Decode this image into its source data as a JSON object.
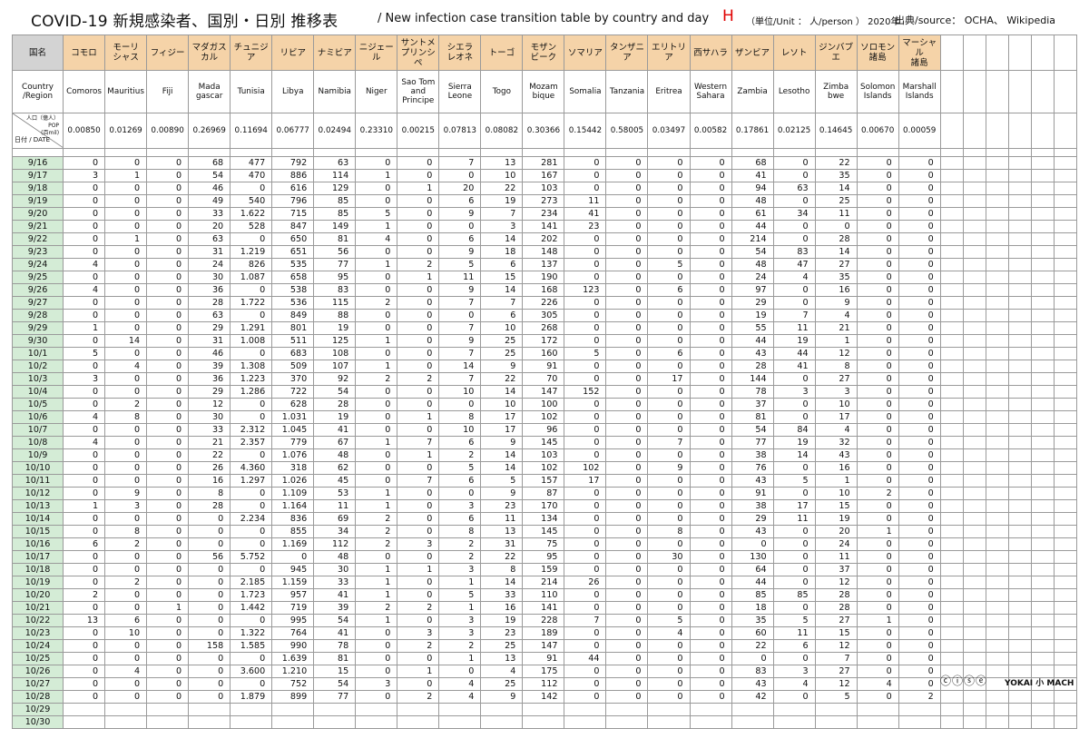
{
  "title": {
    "main": "COVID-19  新規感染者、国別・日別 推移表",
    "sub": "/ New infection case transition table by country and day",
    "letter": "H",
    "unit": "（単位/Unit ： 人/person ） 2020年",
    "source": "出典/source： OCHA、 Wikipedia"
  },
  "header": {
    "corner_ja": "国名",
    "country_region": "Country\n/Region",
    "pop_label": "人口（億人）\nPOP\n(百mil)",
    "date_label": "日付 / DATE"
  },
  "countries": [
    {
      "ja": "コモロ",
      "en": "Comoros",
      "pop": "0.00850"
    },
    {
      "ja": "モーリ\nシャス",
      "en": "Mauritius",
      "pop": "0.01269"
    },
    {
      "ja": "フィジー",
      "en": "Fiji",
      "pop": "0.00890"
    },
    {
      "ja": "マダガス\nカル",
      "en": "Mada\ngascar",
      "pop": "0.26969"
    },
    {
      "ja": "チュニジア",
      "en": "Tunisia",
      "pop": "0.11694"
    },
    {
      "ja": "リビア",
      "en": "Libya",
      "pop": "0.06777"
    },
    {
      "ja": "ナミビア",
      "en": "Namibia",
      "pop": "0.02494"
    },
    {
      "ja": "ニジェール",
      "en": "Niger",
      "pop": "0.23310"
    },
    {
      "ja": "サントメ\nプリンシペ",
      "en": "Sao Tom\nand\nPrincipe",
      "pop": "0.00215"
    },
    {
      "ja": "シエラ\nレオネ",
      "en": "Sierra\nLeone",
      "pop": "0.07813"
    },
    {
      "ja": "トーゴ",
      "en": "Togo",
      "pop": "0.08082"
    },
    {
      "ja": "モザン\nビーク",
      "en": "Mozam\nbique",
      "pop": "0.30366"
    },
    {
      "ja": "ソマリア",
      "en": "Somalia",
      "pop": "0.15442"
    },
    {
      "ja": "タンザニア",
      "en": "Tanzania",
      "pop": "0.58005"
    },
    {
      "ja": "エリトリア",
      "en": "Eritrea",
      "pop": "0.03497"
    },
    {
      "ja": "西サハラ",
      "en": "Western\nSahara",
      "pop": "0.00582"
    },
    {
      "ja": "ザンビア",
      "en": "Zambia",
      "pop": "0.17861"
    },
    {
      "ja": "レソト",
      "en": "Lesotho",
      "pop": "0.02125"
    },
    {
      "ja": "ジンバブエ",
      "en": "Zimba\nbwe",
      "pop": "0.14645"
    },
    {
      "ja": "ソロモン\n諸島",
      "en": "Solomon\nIslands",
      "pop": "0.00670"
    },
    {
      "ja": "マーシャル\n諸島",
      "en": "Marshall\nIslands",
      "pop": "0.00059"
    }
  ],
  "rows": [
    {
      "date": "9/16",
      "v": [
        "0",
        "0",
        "0",
        "68",
        "477",
        "792",
        "63",
        "0",
        "0",
        "7",
        "13",
        "281",
        "0",
        "0",
        "0",
        "0",
        "68",
        "0",
        "22",
        "0",
        "0"
      ]
    },
    {
      "date": "9/17",
      "v": [
        "3",
        "1",
        "0",
        "54",
        "470",
        "886",
        "114",
        "1",
        "0",
        "0",
        "10",
        "167",
        "0",
        "0",
        "0",
        "0",
        "41",
        "0",
        "35",
        "0",
        "0"
      ]
    },
    {
      "date": "9/18",
      "v": [
        "0",
        "0",
        "0",
        "46",
        "0",
        "616",
        "129",
        "0",
        "1",
        "20",
        "22",
        "103",
        "0",
        "0",
        "0",
        "0",
        "94",
        "63",
        "14",
        "0",
        "0"
      ]
    },
    {
      "date": "9/19",
      "v": [
        "0",
        "0",
        "0",
        "49",
        "540",
        "796",
        "85",
        "0",
        "0",
        "6",
        "19",
        "273",
        "11",
        "0",
        "0",
        "0",
        "48",
        "0",
        "25",
        "0",
        "0"
      ]
    },
    {
      "date": "9/20",
      "v": [
        "0",
        "0",
        "0",
        "33",
        "1.622",
        "715",
        "85",
        "5",
        "0",
        "9",
        "7",
        "234",
        "41",
        "0",
        "0",
        "0",
        "61",
        "34",
        "11",
        "0",
        "0"
      ]
    },
    {
      "date": "9/21",
      "v": [
        "0",
        "0",
        "0",
        "20",
        "528",
        "847",
        "149",
        "1",
        "0",
        "0",
        "3",
        "141",
        "23",
        "0",
        "0",
        "0",
        "44",
        "0",
        "0",
        "0",
        "0"
      ]
    },
    {
      "date": "9/22",
      "v": [
        "0",
        "1",
        "0",
        "63",
        "0",
        "650",
        "81",
        "4",
        "0",
        "6",
        "14",
        "202",
        "0",
        "0",
        "0",
        "0",
        "214",
        "0",
        "28",
        "0",
        "0"
      ]
    },
    {
      "date": "9/23",
      "v": [
        "0",
        "0",
        "0",
        "31",
        "1.219",
        "651",
        "56",
        "0",
        "0",
        "9",
        "18",
        "148",
        "0",
        "0",
        "0",
        "0",
        "54",
        "83",
        "14",
        "0",
        "0"
      ]
    },
    {
      "date": "9/24",
      "v": [
        "4",
        "0",
        "0",
        "24",
        "826",
        "535",
        "77",
        "1",
        "2",
        "5",
        "6",
        "137",
        "0",
        "0",
        "5",
        "0",
        "48",
        "47",
        "27",
        "0",
        "0"
      ]
    },
    {
      "date": "9/25",
      "v": [
        "0",
        "0",
        "0",
        "30",
        "1.087",
        "658",
        "95",
        "0",
        "1",
        "11",
        "15",
        "190",
        "0",
        "0",
        "0",
        "0",
        "24",
        "4",
        "35",
        "0",
        "0"
      ]
    },
    {
      "date": "9/26",
      "v": [
        "4",
        "0",
        "0",
        "36",
        "0",
        "538",
        "83",
        "0",
        "0",
        "9",
        "14",
        "168",
        "123",
        "0",
        "6",
        "0",
        "97",
        "0",
        "16",
        "0",
        "0"
      ]
    },
    {
      "date": "9/27",
      "v": [
        "0",
        "0",
        "0",
        "28",
        "1.722",
        "536",
        "115",
        "2",
        "0",
        "7",
        "7",
        "226",
        "0",
        "0",
        "0",
        "0",
        "29",
        "0",
        "9",
        "0",
        "0"
      ]
    },
    {
      "date": "9/28",
      "v": [
        "0",
        "0",
        "0",
        "63",
        "0",
        "849",
        "88",
        "0",
        "0",
        "0",
        "6",
        "305",
        "0",
        "0",
        "0",
        "0",
        "19",
        "7",
        "4",
        "0",
        "0"
      ]
    },
    {
      "date": "9/29",
      "v": [
        "1",
        "0",
        "0",
        "29",
        "1.291",
        "801",
        "19",
        "0",
        "0",
        "7",
        "10",
        "268",
        "0",
        "0",
        "0",
        "0",
        "55",
        "11",
        "21",
        "0",
        "0"
      ]
    },
    {
      "date": "9/30",
      "v": [
        "0",
        "14",
        "0",
        "31",
        "1.008",
        "511",
        "125",
        "1",
        "0",
        "9",
        "25",
        "172",
        "0",
        "0",
        "0",
        "0",
        "44",
        "19",
        "1",
        "0",
        "0"
      ]
    },
    {
      "date": "10/1",
      "v": [
        "5",
        "0",
        "0",
        "46",
        "0",
        "683",
        "108",
        "0",
        "0",
        "7",
        "25",
        "160",
        "5",
        "0",
        "6",
        "0",
        "43",
        "44",
        "12",
        "0",
        "0"
      ]
    },
    {
      "date": "10/2",
      "v": [
        "0",
        "4",
        "0",
        "39",
        "1.308",
        "509",
        "107",
        "1",
        "0",
        "14",
        "9",
        "91",
        "0",
        "0",
        "0",
        "0",
        "28",
        "41",
        "8",
        "0",
        "0"
      ]
    },
    {
      "date": "10/3",
      "v": [
        "3",
        "0",
        "0",
        "36",
        "1.223",
        "370",
        "92",
        "2",
        "2",
        "7",
        "22",
        "70",
        "0",
        "0",
        "17",
        "0",
        "144",
        "0",
        "27",
        "0",
        "0"
      ]
    },
    {
      "date": "10/4",
      "v": [
        "0",
        "0",
        "0",
        "29",
        "1.286",
        "722",
        "54",
        "0",
        "0",
        "10",
        "14",
        "147",
        "152",
        "0",
        "0",
        "0",
        "78",
        "3",
        "3",
        "0",
        "0"
      ]
    },
    {
      "date": "10/5",
      "v": [
        "0",
        "2",
        "0",
        "12",
        "0",
        "628",
        "28",
        "0",
        "0",
        "0",
        "10",
        "100",
        "0",
        "0",
        "0",
        "0",
        "37",
        "0",
        "10",
        "0",
        "0"
      ]
    },
    {
      "date": "10/6",
      "v": [
        "4",
        "8",
        "0",
        "30",
        "0",
        "1.031",
        "19",
        "0",
        "1",
        "8",
        "17",
        "102",
        "0",
        "0",
        "0",
        "0",
        "81",
        "0",
        "17",
        "0",
        "0"
      ]
    },
    {
      "date": "10/7",
      "v": [
        "0",
        "0",
        "0",
        "33",
        "2.312",
        "1.045",
        "41",
        "0",
        "0",
        "10",
        "17",
        "96",
        "0",
        "0",
        "0",
        "0",
        "54",
        "84",
        "4",
        "0",
        "0"
      ]
    },
    {
      "date": "10/8",
      "v": [
        "4",
        "0",
        "0",
        "21",
        "2.357",
        "779",
        "67",
        "1",
        "7",
        "6",
        "9",
        "145",
        "0",
        "0",
        "7",
        "0",
        "77",
        "19",
        "32",
        "0",
        "0"
      ]
    },
    {
      "date": "10/9",
      "v": [
        "0",
        "0",
        "0",
        "22",
        "0",
        "1.076",
        "48",
        "0",
        "1",
        "2",
        "14",
        "103",
        "0",
        "0",
        "0",
        "0",
        "38",
        "14",
        "43",
        "0",
        "0"
      ]
    },
    {
      "date": "10/10",
      "v": [
        "0",
        "0",
        "0",
        "26",
        "4.360",
        "318",
        "62",
        "0",
        "0",
        "5",
        "14",
        "102",
        "102",
        "0",
        "9",
        "0",
        "76",
        "0",
        "16",
        "0",
        "0"
      ]
    },
    {
      "date": "10/11",
      "v": [
        "0",
        "0",
        "0",
        "16",
        "1.297",
        "1.026",
        "45",
        "0",
        "7",
        "6",
        "5",
        "157",
        "17",
        "0",
        "0",
        "0",
        "43",
        "5",
        "1",
        "0",
        "0"
      ]
    },
    {
      "date": "10/12",
      "v": [
        "0",
        "9",
        "0",
        "8",
        "0",
        "1.109",
        "53",
        "1",
        "0",
        "0",
        "9",
        "87",
        "0",
        "0",
        "0",
        "0",
        "91",
        "0",
        "10",
        "2",
        "0"
      ]
    },
    {
      "date": "10/13",
      "v": [
        "1",
        "3",
        "0",
        "28",
        "0",
        "1.164",
        "11",
        "1",
        "0",
        "3",
        "23",
        "170",
        "0",
        "0",
        "0",
        "0",
        "38",
        "17",
        "15",
        "0",
        "0"
      ]
    },
    {
      "date": "10/14",
      "v": [
        "0",
        "0",
        "0",
        "0",
        "2.234",
        "836",
        "69",
        "2",
        "0",
        "6",
        "11",
        "134",
        "0",
        "0",
        "0",
        "0",
        "29",
        "11",
        "19",
        "0",
        "0"
      ]
    },
    {
      "date": "10/15",
      "v": [
        "0",
        "8",
        "0",
        "0",
        "0",
        "855",
        "34",
        "2",
        "0",
        "8",
        "13",
        "145",
        "0",
        "0",
        "8",
        "0",
        "43",
        "0",
        "20",
        "1",
        "0"
      ]
    },
    {
      "date": "10/16",
      "v": [
        "6",
        "2",
        "0",
        "0",
        "0",
        "1.169",
        "112",
        "2",
        "3",
        "2",
        "31",
        "75",
        "0",
        "0",
        "0",
        "0",
        "0",
        "0",
        "24",
        "0",
        "0"
      ]
    },
    {
      "date": "10/17",
      "v": [
        "0",
        "0",
        "0",
        "56",
        "5.752",
        "0",
        "48",
        "0",
        "0",
        "2",
        "22",
        "95",
        "0",
        "0",
        "30",
        "0",
        "130",
        "0",
        "11",
        "0",
        "0"
      ]
    },
    {
      "date": "10/18",
      "v": [
        "0",
        "0",
        "0",
        "0",
        "0",
        "945",
        "30",
        "1",
        "1",
        "3",
        "8",
        "159",
        "0",
        "0",
        "0",
        "0",
        "64",
        "0",
        "37",
        "0",
        "0"
      ]
    },
    {
      "date": "10/19",
      "v": [
        "0",
        "2",
        "0",
        "0",
        "2.185",
        "1.159",
        "33",
        "1",
        "0",
        "1",
        "14",
        "214",
        "26",
        "0",
        "0",
        "0",
        "44",
        "0",
        "12",
        "0",
        "0"
      ]
    },
    {
      "date": "10/20",
      "v": [
        "2",
        "0",
        "0",
        "0",
        "1.723",
        "957",
        "41",
        "1",
        "0",
        "5",
        "33",
        "110",
        "0",
        "0",
        "0",
        "0",
        "85",
        "85",
        "28",
        "0",
        "0"
      ]
    },
    {
      "date": "10/21",
      "v": [
        "0",
        "0",
        "1",
        "0",
        "1.442",
        "719",
        "39",
        "2",
        "2",
        "1",
        "16",
        "141",
        "0",
        "0",
        "0",
        "0",
        "18",
        "0",
        "28",
        "0",
        "0"
      ]
    },
    {
      "date": "10/22",
      "v": [
        "13",
        "6",
        "0",
        "0",
        "0",
        "995",
        "54",
        "1",
        "0",
        "3",
        "19",
        "228",
        "7",
        "0",
        "5",
        "0",
        "35",
        "5",
        "27",
        "1",
        "0"
      ]
    },
    {
      "date": "10/23",
      "v": [
        "0",
        "10",
        "0",
        "0",
        "1.322",
        "764",
        "41",
        "0",
        "3",
        "3",
        "23",
        "189",
        "0",
        "0",
        "4",
        "0",
        "60",
        "11",
        "15",
        "0",
        "0"
      ]
    },
    {
      "date": "10/24",
      "v": [
        "0",
        "0",
        "0",
        "158",
        "1.585",
        "990",
        "78",
        "0",
        "2",
        "2",
        "25",
        "147",
        "0",
        "0",
        "0",
        "0",
        "22",
        "6",
        "12",
        "0",
        "0"
      ]
    },
    {
      "date": "10/25",
      "v": [
        "0",
        "0",
        "0",
        "0",
        "0",
        "1.639",
        "81",
        "0",
        "0",
        "1",
        "13",
        "91",
        "44",
        "0",
        "0",
        "0",
        "0",
        "0",
        "7",
        "0",
        "0"
      ]
    },
    {
      "date": "10/26",
      "v": [
        "0",
        "4",
        "0",
        "0",
        "3.600",
        "1.210",
        "15",
        "0",
        "1",
        "0",
        "4",
        "175",
        "0",
        "0",
        "0",
        "0",
        "83",
        "3",
        "27",
        "0",
        "0"
      ]
    },
    {
      "date": "10/27",
      "v": [
        "0",
        "0",
        "0",
        "0",
        "0",
        "752",
        "54",
        "3",
        "0",
        "4",
        "25",
        "112",
        "0",
        "0",
        "0",
        "0",
        "43",
        "4",
        "12",
        "4",
        "0"
      ]
    },
    {
      "date": "10/28",
      "v": [
        "0",
        "0",
        "0",
        "0",
        "1.879",
        "899",
        "77",
        "0",
        "2",
        "4",
        "9",
        "142",
        "0",
        "0",
        "0",
        "0",
        "42",
        "0",
        "5",
        "0",
        "2"
      ]
    },
    {
      "date": "10/29",
      "v": []
    },
    {
      "date": "10/30",
      "v": []
    }
  ],
  "footer": {
    "badges": "ⓒⓘⓢⓔ",
    "logo": "YOKAI 小 MACH"
  }
}
